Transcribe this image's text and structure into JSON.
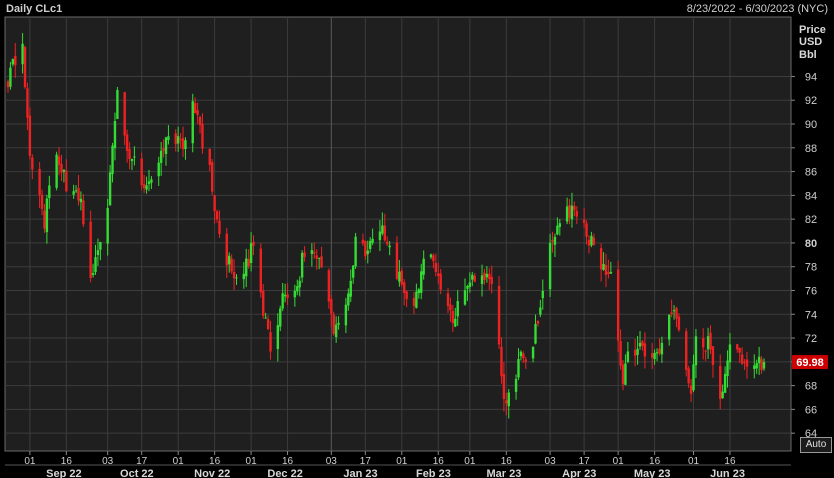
{
  "header": {
    "title": "Daily CLc1",
    "date_range": "8/23/2022 - 6/30/2023 (NYC)"
  },
  "axis": {
    "unit_lines": [
      "Price",
      "USD",
      "Bbl"
    ],
    "auto_label": "Auto"
  },
  "last_price_label": "69.98",
  "colors": {
    "up": "#33dd33",
    "down": "#ee2222",
    "last_badge": "#cc0000",
    "grid": "#3c3c3c",
    "plot_bg": "#1f1f1f"
  },
  "chart_data": {
    "type": "candlestick",
    "y_range": [
      62.5,
      99
    ],
    "y_ticks": [
      64,
      66,
      68,
      70,
      72,
      74,
      76,
      78,
      80,
      82,
      84,
      86,
      88,
      90,
      92,
      94
    ],
    "x_range": [
      "2022-08-23",
      "2023-06-30"
    ],
    "date_ticks": [
      {
        "date": "2022-09-01",
        "label": "01",
        "major": false
      },
      {
        "date": "2022-09-16",
        "label": "16",
        "major": false
      },
      {
        "date": "2022-10-03",
        "label": "03",
        "major": false
      },
      {
        "date": "2022-10-17",
        "label": "17",
        "major": false
      },
      {
        "date": "2022-11-01",
        "label": "01",
        "major": false
      },
      {
        "date": "2022-11-16",
        "label": "16",
        "major": false
      },
      {
        "date": "2022-12-01",
        "label": "01",
        "major": false
      },
      {
        "date": "2022-12-16",
        "label": "16",
        "major": false
      },
      {
        "date": "2023-01-03",
        "label": "03",
        "major": true
      },
      {
        "date": "2023-01-17",
        "label": "17",
        "major": false
      },
      {
        "date": "2023-02-01",
        "label": "01",
        "major": false
      },
      {
        "date": "2023-02-16",
        "label": "16",
        "major": false
      },
      {
        "date": "2023-03-01",
        "label": "01",
        "major": false
      },
      {
        "date": "2023-03-16",
        "label": "16",
        "major": false
      },
      {
        "date": "2023-04-03",
        "label": "03",
        "major": false
      },
      {
        "date": "2023-04-17",
        "label": "17",
        "major": false
      },
      {
        "date": "2023-05-01",
        "label": "01",
        "major": false
      },
      {
        "date": "2023-05-16",
        "label": "16",
        "major": false
      },
      {
        "date": "2023-06-01",
        "label": "01",
        "major": false
      },
      {
        "date": "2023-06-16",
        "label": "16",
        "major": false
      }
    ],
    "month_labels": [
      {
        "date": "2022-09-15",
        "label": "Sep 22"
      },
      {
        "date": "2022-10-15",
        "label": "Oct 22"
      },
      {
        "date": "2022-11-15",
        "label": "Nov 22"
      },
      {
        "date": "2022-12-15",
        "label": "Dec 22"
      },
      {
        "date": "2023-01-15",
        "label": "Jan 23"
      },
      {
        "date": "2023-02-14",
        "label": "Feb 23"
      },
      {
        "date": "2023-03-15",
        "label": "Mar 23"
      },
      {
        "date": "2023-04-15",
        "label": "Apr 23"
      },
      {
        "date": "2023-05-15",
        "label": "May 23"
      },
      {
        "date": "2023-06-15",
        "label": "Jun 23"
      }
    ],
    "close_path": [
      [
        "2022-08-23",
        93.7
      ],
      [
        "2022-08-29",
        97.0
      ],
      [
        "2022-09-01",
        86.6
      ],
      [
        "2022-09-07",
        81.9
      ],
      [
        "2022-09-12",
        87.8
      ],
      [
        "2022-09-16",
        85.1
      ],
      [
        "2022-09-22",
        83.5
      ],
      [
        "2022-09-26",
        76.7
      ],
      [
        "2022-10-03",
        83.6
      ],
      [
        "2022-10-07",
        92.6
      ],
      [
        "2022-10-12",
        87.3
      ],
      [
        "2022-10-17",
        85.5
      ],
      [
        "2022-10-21",
        85.0
      ],
      [
        "2022-10-27",
        89.1
      ],
      [
        "2022-11-03",
        88.2
      ],
      [
        "2022-11-07",
        91.8
      ],
      [
        "2022-11-14",
        85.9
      ],
      [
        "2022-11-18",
        80.1
      ],
      [
        "2022-11-23",
        77.9
      ],
      [
        "2022-11-28",
        77.3
      ],
      [
        "2022-12-02",
        80.0
      ],
      [
        "2022-12-06",
        74.3
      ],
      [
        "2022-12-09",
        71.0
      ],
      [
        "2022-12-15",
        76.1
      ],
      [
        "2022-12-20",
        76.1
      ],
      [
        "2022-12-23",
        79.6
      ],
      [
        "2022-12-29",
        78.4
      ],
      [
        "2023-01-04",
        72.8
      ],
      [
        "2023-01-09",
        74.6
      ],
      [
        "2023-01-13",
        79.9
      ],
      [
        "2023-01-18",
        79.5
      ],
      [
        "2023-01-23",
        81.5
      ],
      [
        "2023-01-27",
        79.7
      ],
      [
        "2023-02-01",
        76.5
      ],
      [
        "2023-02-06",
        74.1
      ],
      [
        "2023-02-09",
        78.1
      ],
      [
        "2023-02-14",
        79.1
      ],
      [
        "2023-02-17",
        76.3
      ],
      [
        "2023-02-22",
        73.9
      ],
      [
        "2023-02-28",
        77.0
      ],
      [
        "2023-03-07",
        77.6
      ],
      [
        "2023-03-10",
        76.7
      ],
      [
        "2023-03-15",
        67.6
      ],
      [
        "2023-03-17",
        66.7
      ],
      [
        "2023-03-22",
        70.9
      ],
      [
        "2023-03-24",
        69.3
      ],
      [
        "2023-03-30",
        74.4
      ],
      [
        "2023-04-03",
        80.4
      ],
      [
        "2023-04-06",
        80.7
      ],
      [
        "2023-04-12",
        83.3
      ],
      [
        "2023-04-18",
        80.8
      ],
      [
        "2023-04-24",
        77.8
      ],
      [
        "2023-04-28",
        76.8
      ],
      [
        "2023-05-03",
        68.6
      ],
      [
        "2023-05-05",
        71.3
      ],
      [
        "2023-05-11",
        70.9
      ],
      [
        "2023-05-16",
        70.9
      ],
      [
        "2023-05-19",
        71.6
      ],
      [
        "2023-05-24",
        74.3
      ],
      [
        "2023-05-31",
        68.1
      ],
      [
        "2023-06-02",
        71.7
      ],
      [
        "2023-06-08",
        71.3
      ],
      [
        "2023-06-12",
        67.1
      ],
      [
        "2023-06-16",
        71.8
      ],
      [
        "2023-06-23",
        69.2
      ],
      [
        "2023-06-26",
        69.4
      ],
      [
        "2023-06-30",
        69.98
      ]
    ],
    "gap": [
      "2023-03-29",
      "2023-04-01"
    ],
    "last_value": 69.98
  }
}
